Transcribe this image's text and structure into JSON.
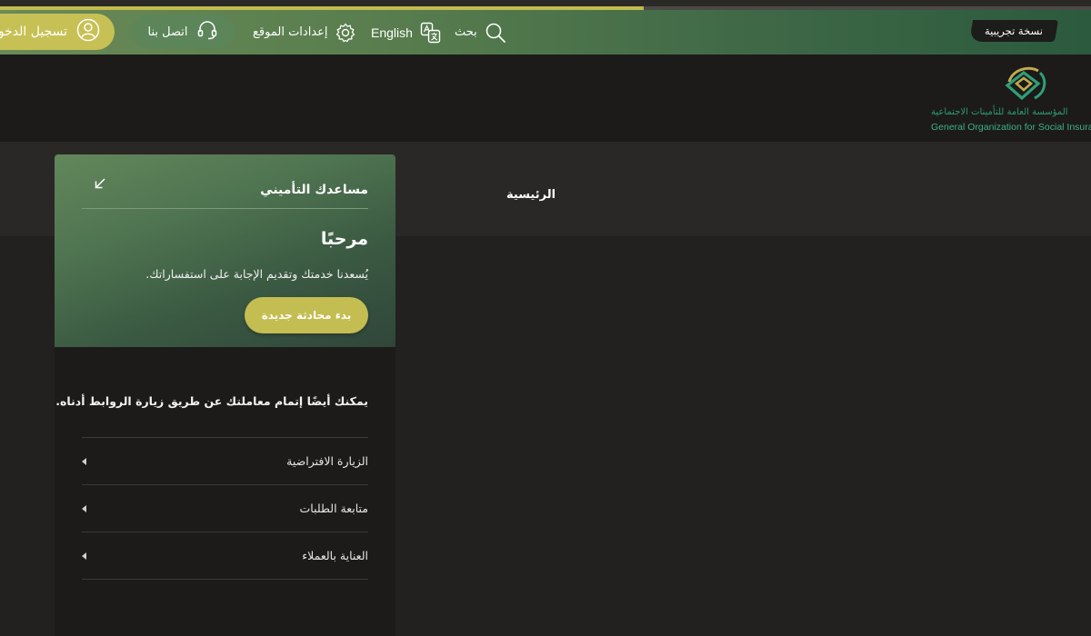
{
  "progress": {
    "fraction": 0.59,
    "fill_color": "#c2bb4e"
  },
  "nav": {
    "login_label": "تسجيل الدخول",
    "contact_label": "اتصل بنا",
    "settings_label": "إعدادات الموقع",
    "language_label": "English",
    "search_label": "بحث",
    "beta_label": "نسخة تجريبية",
    "login_icon": "user-icon",
    "contact_icon": "headset-icon",
    "settings_icon": "gear-icon",
    "language_icon": "translate-icon",
    "search_icon": "search-icon"
  },
  "logo": {
    "name_ar": "المؤسسة العامة للتأمينات الاجتماعية",
    "name_en": "General Organization for Social Insurance"
  },
  "breadcrumb": {
    "home": "الرئيسية"
  },
  "assistant": {
    "title": "مساعدك التأميني",
    "collapse_icon": "arrow-down-left-icon",
    "welcome_title": "مرحبًا",
    "welcome_text": "يُسعدنا خدمتك وتقديم الإجابة على استفساراتك.",
    "new_chat_label": "بدء محادثة جديدة",
    "links_intro": "يمكنك أيضًا إتمام معاملتك عن طريق زيارة الروابط أدناه.",
    "links": [
      {
        "label": "الزيارة الافتراضية"
      },
      {
        "label": "متابعة الطلبات"
      },
      {
        "label": "العناية بالعملاء"
      }
    ]
  },
  "colors": {
    "brand_green": "#4e7350",
    "accent_gold": "#c4bd52",
    "background": "#222120"
  }
}
